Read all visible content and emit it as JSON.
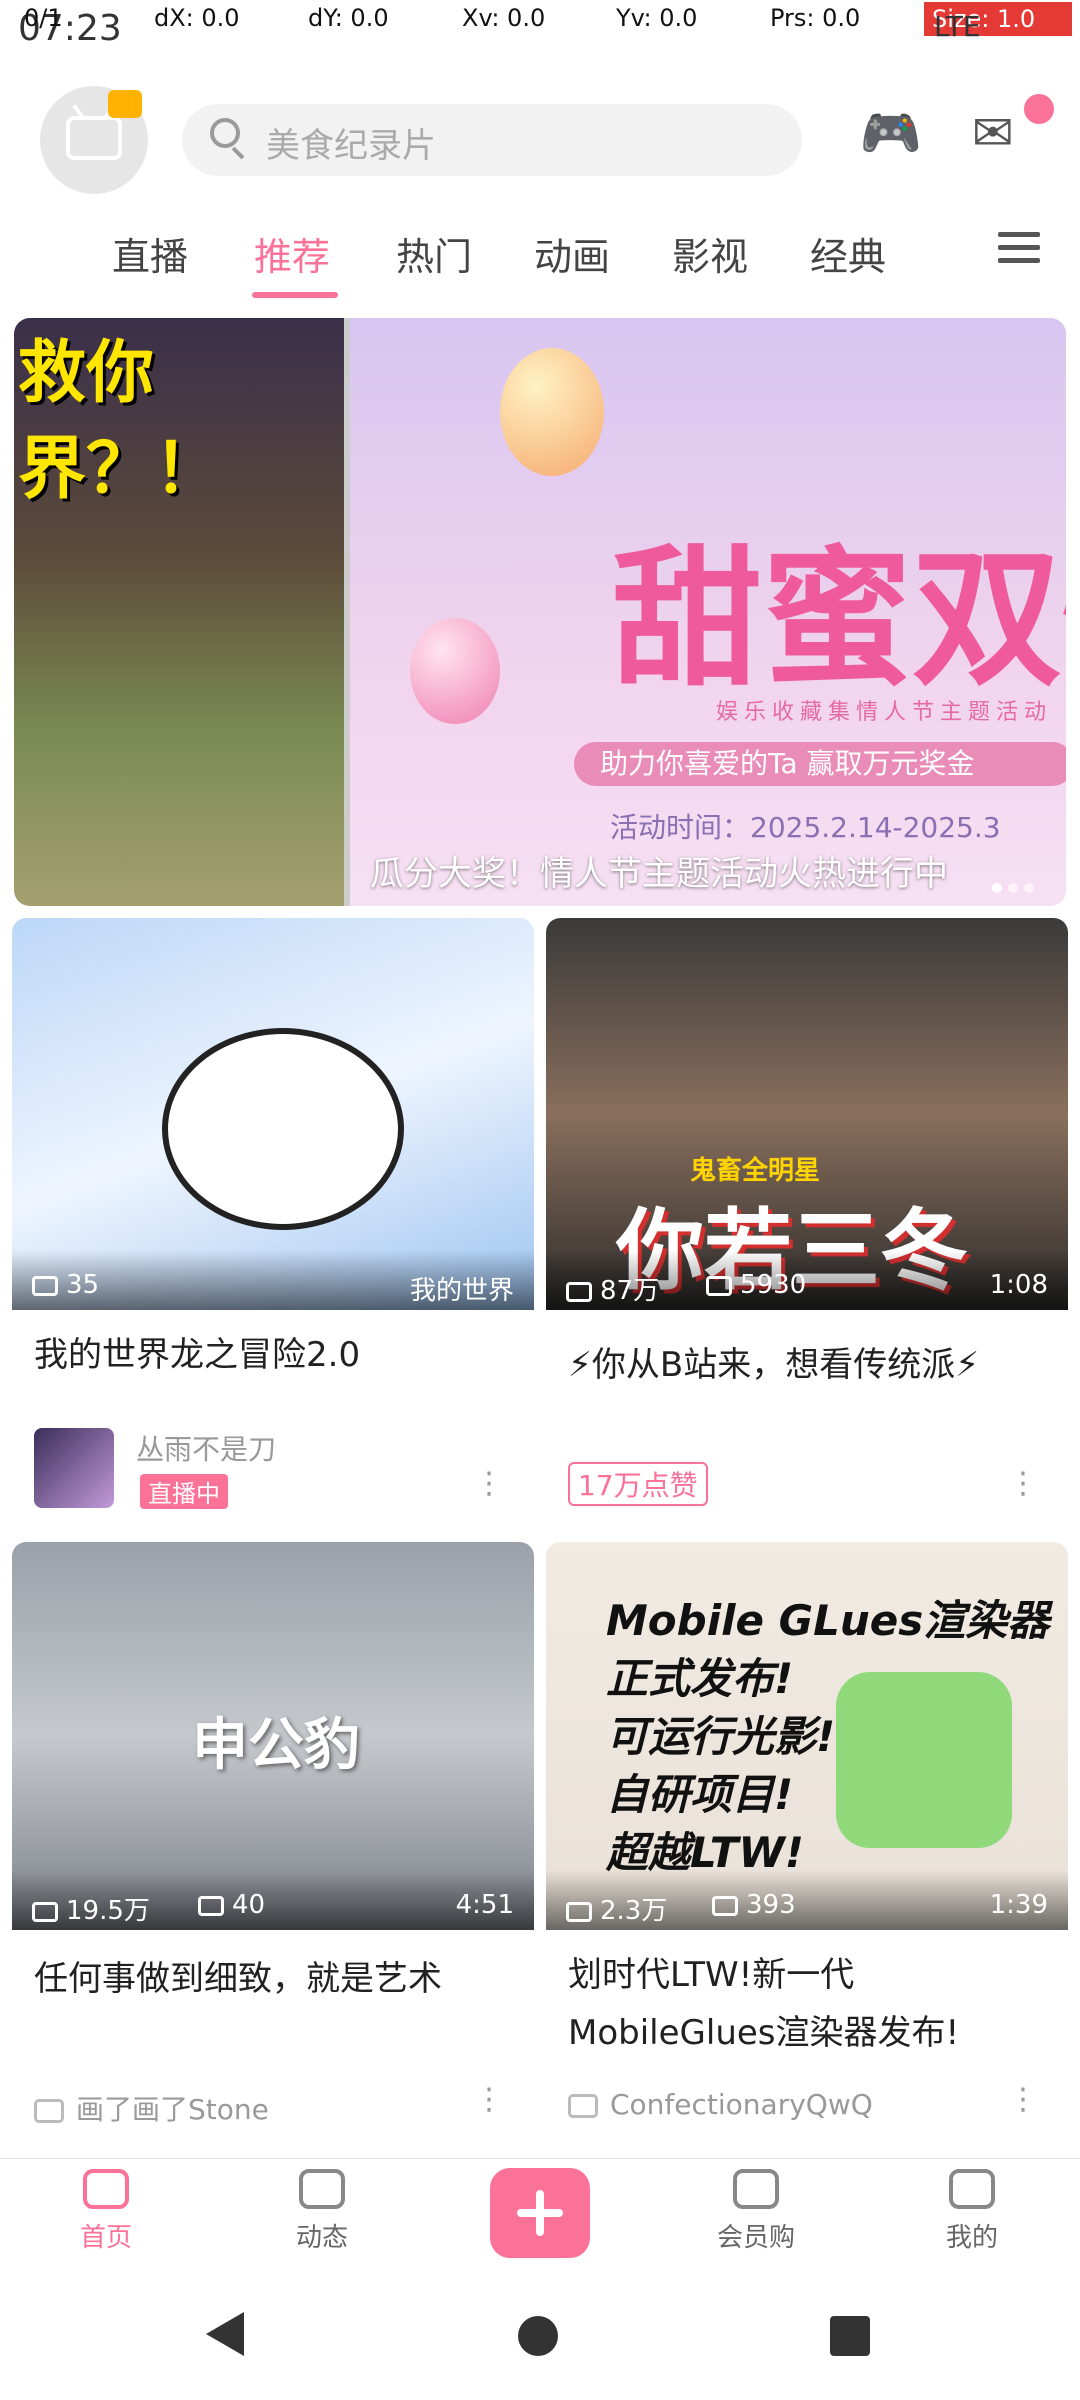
{
  "debug_overlay": {
    "pointer": "0/1",
    "dx": "dX: 0.0",
    "dy": "dY: 0.0",
    "xv": "Xv: 0.0",
    "yv": "Yv: 0.0",
    "prs": "Prs: 0.0",
    "size": "Size: 1.0"
  },
  "status_bar": {
    "time": "07:23",
    "network": "LTE"
  },
  "header": {
    "search_placeholder": "美食纪录片"
  },
  "tabs": [
    {
      "label": "直播",
      "active": false
    },
    {
      "label": "推荐",
      "active": true
    },
    {
      "label": "热门",
      "active": false
    },
    {
      "label": "动画",
      "active": false
    },
    {
      "label": "影视",
      "active": false
    },
    {
      "label": "经典",
      "active": false
    }
  ],
  "banner": {
    "left_text": "救你\n界？！",
    "headline": "甜蜜双情",
    "subline": "娱乐收藏集情人节主题活动",
    "pill": "助力你喜爱的Ta 赢取万元奖金",
    "date": "活动时间：2025.2.14-2025.3",
    "caption": "瓜分大奖！情人节主题活动火热进行中"
  },
  "cards": [
    {
      "title": "我的世界龙之冒险2.0",
      "stat1": "35",
      "tag": "我的世界",
      "uploader": "丛雨不是刀",
      "live": "直播中"
    },
    {
      "title": "⚡你从B站来，想看传统派⚡",
      "stat1": "87万",
      "stat2": "5930",
      "duration": "1:08",
      "thumb_text": "你若三冬",
      "thumb_small": "鬼畜全明星",
      "like": "17万点赞"
    },
    {
      "title": "任何事做到细致，就是艺术",
      "stat1": "19.5万",
      "stat2": "40",
      "duration": "4:51",
      "thumb_text": "申公豹",
      "uploader": "画了画了Stone"
    },
    {
      "title": "划时代LTW!新一代MobileGlues渲染器发布!",
      "stat1": "2.3万",
      "stat2": "393",
      "duration": "1:39",
      "thumb_text": "Mobile GLues渲染器\n正式发布!\n可运行光影!\n自研项目!\n超越LTW!",
      "uploader": "ConfectionaryQwQ"
    }
  ],
  "bottom_nav": [
    {
      "label": "首页",
      "active": true
    },
    {
      "label": "动态",
      "active": false
    },
    {
      "label": "",
      "active": false
    },
    {
      "label": "会员购",
      "active": false
    },
    {
      "label": "我的",
      "active": false
    }
  ],
  "colors": {
    "accent": "#fb7299"
  }
}
